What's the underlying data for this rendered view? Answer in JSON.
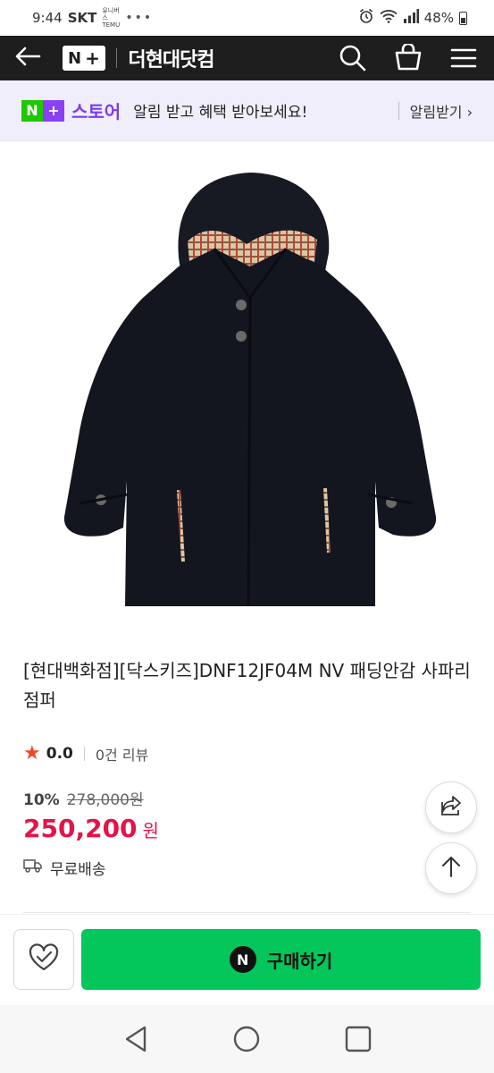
{
  "status_bar": {
    "time": "9:44",
    "carrier": "SKT",
    "carrier_badge": "유니버스 TEMU",
    "notification_dots": "•••",
    "battery": "48%"
  },
  "header": {
    "logo_n": "N",
    "logo_plus": "+",
    "site_title": "더현대닷컴",
    "icons": [
      "back-arrow-icon",
      "search-icon",
      "cart-icon",
      "menu-icon"
    ]
  },
  "store_banner": {
    "badge_n": "N",
    "badge_plus": "+",
    "store_name": "스토어",
    "message": "알림 받고 혜택 받아보세요!",
    "notify_label": "알림받기 ›",
    "accent_color": "#7a3df0"
  },
  "product": {
    "image_icon": "navy-hooded-jacket-image",
    "title": "[현대백화점][닥스키즈]DNF12JF04M NV 패딩안감 사파리점퍼",
    "rating": "0.0",
    "review_count": "0건 리뷰",
    "discount_rate": "10%",
    "original_price": "278,000원",
    "sale_price": "250,200",
    "currency": "원",
    "shipping": "무료배송",
    "price_color": "#e2144a"
  },
  "floating_buttons": {
    "share_icon": "share-icon",
    "top_icon": "arrow-up-icon"
  },
  "action_bar": {
    "wish_icon": "heart-check-icon",
    "npay_letter": "N",
    "buy_label": "구매하기",
    "buy_color": "#03c75a"
  },
  "system_nav": {
    "icons": [
      "back-triangle-icon",
      "home-circle-icon",
      "recents-square-icon"
    ]
  }
}
